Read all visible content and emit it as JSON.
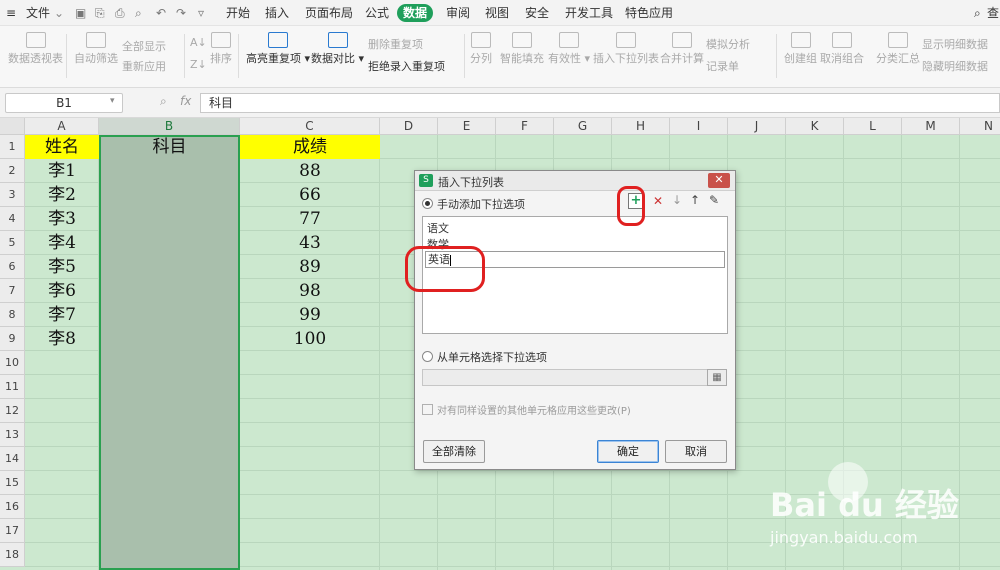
{
  "menubar": {
    "file_label": "文件",
    "items": [
      "开始",
      "插入",
      "页面布局",
      "公式",
      "数据",
      "审阅",
      "视图",
      "安全",
      "开发工具",
      "特色应用"
    ],
    "active_item": "数据",
    "search_label": "查"
  },
  "toolbar": {
    "pivot": "数据透视表",
    "autofilter": "自动筛选",
    "show_all": "全部显示",
    "reapply": "重新应用",
    "sort": "排序",
    "highlight_dup": "高亮重复项",
    "compare": "数据对比",
    "delete_dup": "删除重复项",
    "reject_dup": "拒绝录入重复项",
    "split": "分列",
    "smart_fill": "智能填充",
    "validity": "有效性",
    "insert_dropdown": "插入下拉列表",
    "consolidate": "合并计算",
    "simulate": "模拟分析",
    "record": "记录单",
    "group": "创建组",
    "ungroup": "取消组合",
    "subtotal": "分类汇总",
    "show_detail": "显示明细数据",
    "hide_detail": "隐藏明细数据"
  },
  "formula_bar": {
    "name_box": "B1",
    "fx": "fx",
    "value": "科目"
  },
  "sheet": {
    "columns": [
      "A",
      "B",
      "C",
      "D",
      "E",
      "F",
      "G",
      "H",
      "I",
      "J",
      "K",
      "L",
      "M",
      "N"
    ],
    "rows": [
      "1",
      "2",
      "3",
      "4",
      "5",
      "6",
      "7",
      "8",
      "9",
      "10",
      "11",
      "12",
      "13",
      "14",
      "15",
      "16",
      "17",
      "18"
    ],
    "header": {
      "a": "姓名",
      "b": "科目",
      "c": "成绩"
    },
    "names": [
      "李1",
      "李2",
      "李3",
      "李4",
      "李5",
      "李6",
      "李7",
      "李8"
    ],
    "scores": [
      "88",
      "66",
      "77",
      "43",
      "89",
      "98",
      "99",
      "100"
    ],
    "header_color": "#ffff00",
    "grid_color": "#cce8cf"
  },
  "dialog": {
    "title": "插入下拉列表",
    "manual_option": "手动添加下拉选项",
    "list_items": [
      "语文",
      "数学"
    ],
    "editing_value": "英语",
    "cell_option": "从单元格选择下拉选项",
    "apply_checkbox": "对有同样设置的其他单元格应用这些更改(P)",
    "clear_all": "全部清除",
    "ok": "确定",
    "cancel": "取消"
  },
  "watermark": {
    "brand": "Bai du 经验",
    "url": "jingyan.baidu.com"
  }
}
